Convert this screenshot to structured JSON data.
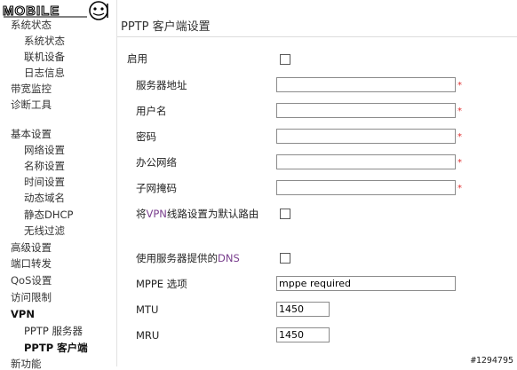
{
  "brand": {
    "logo_text": "MOBILE01"
  },
  "sidebar": {
    "items": [
      {
        "label": "系统状态",
        "level": 1
      },
      {
        "label": "系统状态",
        "level": 2
      },
      {
        "label": "联机设备",
        "level": 2
      },
      {
        "label": "日志信息",
        "level": 2
      },
      {
        "label": "带宽监控",
        "level": 1
      },
      {
        "label": "诊断工具",
        "level": 1
      },
      {
        "label": "基本设置",
        "level": 1
      },
      {
        "label": "网络设置",
        "level": 2
      },
      {
        "label": "名称设置",
        "level": 2
      },
      {
        "label": "时间设置",
        "level": 2
      },
      {
        "label": "动态域名",
        "level": 2
      },
      {
        "label": "静态DHCP",
        "level": 2
      },
      {
        "label": "无线过滤",
        "level": 2
      },
      {
        "label": "高级设置",
        "level": 1
      },
      {
        "label": "端口转发",
        "level": 1
      },
      {
        "label": "QoS设置",
        "level": 1
      },
      {
        "label": "访问限制",
        "level": 1
      },
      {
        "label": "VPN",
        "level": 1
      },
      {
        "label": "PPTP 服务器",
        "level": 2
      },
      {
        "label": "PPTP 客户端",
        "level": 2,
        "active": true
      },
      {
        "label": "新功能",
        "level": 1
      }
    ]
  },
  "page": {
    "title": "PPTP 客户端设置",
    "form": {
      "enable_label": "启用",
      "server_label": "服务器地址",
      "username_label": "用户名",
      "password_label": "密码",
      "office_label": "办公网络",
      "subnet_label": "子网掩码",
      "default_route_label_pre": "将",
      "default_route_label_vpn": "VPN",
      "default_route_label_post": "线路设置为默认路由",
      "dns_label_pre": "使用服务器提供的",
      "dns_label_dns": "DNS",
      "mppe_label": "MPPE 选项",
      "mppe_value": "mppe required",
      "mtu_label": "MTU",
      "mtu_value": "1450",
      "mru_label": "MRU",
      "mru_value": "1450",
      "required_mark": "*"
    }
  },
  "watermark": "#1294795"
}
